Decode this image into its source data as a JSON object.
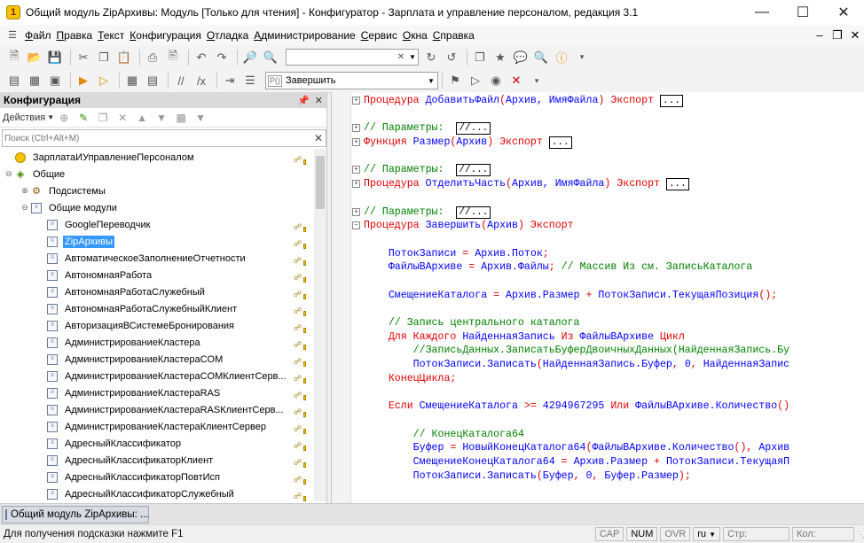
{
  "window": {
    "title": "Общий модуль ZipАрхивы: Модуль [Только для чтения] - Конфигуратор - Зарплата и управление персоналом, редакция 3.1"
  },
  "menu": [
    "Файл",
    "Правка",
    "Текст",
    "Конфигурация",
    "Отладка",
    "Администрирование",
    "Сервис",
    "Окна",
    "Справка"
  ],
  "toolbar": {
    "search_value": "",
    "procedure_value": "Завершить",
    "proc_tag": "P()"
  },
  "config_panel": {
    "title": "Конфигурация",
    "actions_label": "Действия",
    "search_placeholder": "Поиск (Ctrl+Alt+M)"
  },
  "tree": [
    {
      "label": "ЗарплатаИУправлениеПерсоналом",
      "level": 0,
      "exp": "",
      "icon": "root",
      "lock": true
    },
    {
      "label": "Общие",
      "level": 0,
      "exp": "⊖",
      "icon": "common",
      "lock": false
    },
    {
      "label": "Подсистемы",
      "level": 1,
      "exp": "⊕",
      "icon": "subsys",
      "lock": false
    },
    {
      "label": "Общие модули",
      "level": 1,
      "exp": "⊖",
      "icon": "module",
      "lock": false
    },
    {
      "label": "GoogleПереводчик",
      "level": 2,
      "exp": "",
      "icon": "module",
      "lock": true
    },
    {
      "label": "ZipАрхивы",
      "level": 2,
      "exp": "",
      "icon": "module",
      "lock": true,
      "selected": true
    },
    {
      "label": "АвтоматическоеЗаполнениеОтчетности",
      "level": 2,
      "exp": "",
      "icon": "module",
      "lock": true
    },
    {
      "label": "АвтономнаяРабота",
      "level": 2,
      "exp": "",
      "icon": "module",
      "lock": true
    },
    {
      "label": "АвтономнаяРаботаСлужебный",
      "level": 2,
      "exp": "",
      "icon": "module",
      "lock": true
    },
    {
      "label": "АвтономнаяРаботаСлужебныйКлиент",
      "level": 2,
      "exp": "",
      "icon": "module",
      "lock": true
    },
    {
      "label": "АвторизацияВСистемеБронирования",
      "level": 2,
      "exp": "",
      "icon": "module",
      "lock": true
    },
    {
      "label": "АдминистрированиеКластера",
      "level": 2,
      "exp": "",
      "icon": "module",
      "lock": true
    },
    {
      "label": "АдминистрированиеКластераCOM",
      "level": 2,
      "exp": "",
      "icon": "module",
      "lock": true
    },
    {
      "label": "АдминистрированиеКластераCOMКлиентСерв...",
      "level": 2,
      "exp": "",
      "icon": "module",
      "lock": true
    },
    {
      "label": "АдминистрированиеКластераRAS",
      "level": 2,
      "exp": "",
      "icon": "module",
      "lock": true
    },
    {
      "label": "АдминистрированиеКластераRASКлиентСерв...",
      "level": 2,
      "exp": "",
      "icon": "module",
      "lock": true
    },
    {
      "label": "АдминистрированиеКластераКлиентСервер",
      "level": 2,
      "exp": "",
      "icon": "module",
      "lock": true
    },
    {
      "label": "АдресныйКлассификатор",
      "level": 2,
      "exp": "",
      "icon": "module",
      "lock": true
    },
    {
      "label": "АдресныйКлассификаторКлиент",
      "level": 2,
      "exp": "",
      "icon": "module",
      "lock": true
    },
    {
      "label": "АдресныйКлассификаторПовтИсп",
      "level": 2,
      "exp": "",
      "icon": "module",
      "lock": true
    },
    {
      "label": "АдресныйКлассификаторСлужебный",
      "level": 2,
      "exp": "",
      "icon": "module",
      "lock": true
    }
  ],
  "code": [
    {
      "fold": "+",
      "parts": [
        [
          "kw",
          "Процедура "
        ],
        [
          "id",
          "ДобавитьФайл"
        ],
        [
          "kw",
          "("
        ],
        [
          "id",
          "Архив, ИмяФайла"
        ],
        [
          "kw",
          ") Экспорт "
        ],
        [
          "box",
          "..."
        ]
      ]
    },
    {
      "parts": []
    },
    {
      "fold": "+",
      "parts": [
        [
          "cm",
          "// Параметры:  "
        ],
        [
          "box",
          "//..."
        ]
      ]
    },
    {
      "fold": "+",
      "parts": [
        [
          "kw",
          "Функция "
        ],
        [
          "id",
          "Размер"
        ],
        [
          "kw",
          "("
        ],
        [
          "id",
          "Архив"
        ],
        [
          "kw",
          ") Экспорт "
        ],
        [
          "box",
          "..."
        ]
      ]
    },
    {
      "parts": []
    },
    {
      "fold": "+",
      "parts": [
        [
          "cm",
          "// Параметры:  "
        ],
        [
          "box",
          "//..."
        ]
      ]
    },
    {
      "fold": "+",
      "parts": [
        [
          "kw",
          "Процедура "
        ],
        [
          "id",
          "ОтделитьЧасть"
        ],
        [
          "kw",
          "("
        ],
        [
          "id",
          "Архив, ИмяФайла"
        ],
        [
          "kw",
          ") Экспорт "
        ],
        [
          "box",
          "..."
        ]
      ]
    },
    {
      "parts": []
    },
    {
      "fold": "+",
      "parts": [
        [
          "cm",
          "// Параметры:  "
        ],
        [
          "box",
          "//..."
        ]
      ]
    },
    {
      "fold": "-",
      "parts": [
        [
          "kw",
          "Процедура "
        ],
        [
          "id",
          "Завершить"
        ],
        [
          "kw",
          "("
        ],
        [
          "id",
          "Архив"
        ],
        [
          "kw",
          ") Экспорт"
        ]
      ]
    },
    {
      "parts": []
    },
    {
      "parts": [
        [
          "id",
          "    ПотокЗаписи "
        ],
        [
          "kw",
          "= "
        ],
        [
          "id",
          "Архив.Поток"
        ],
        [
          "kw",
          ";"
        ]
      ]
    },
    {
      "parts": [
        [
          "id",
          "    ФайлыВАрхиве "
        ],
        [
          "kw",
          "= "
        ],
        [
          "id",
          "Архив.Файлы"
        ],
        [
          "kw",
          "; "
        ],
        [
          "cm",
          "// Массив Из см. ЗаписьКаталога"
        ]
      ]
    },
    {
      "parts": []
    },
    {
      "parts": [
        [
          "id",
          "    СмещениеКаталога "
        ],
        [
          "kw",
          "= "
        ],
        [
          "id",
          "Архив.Размер "
        ],
        [
          "kw",
          "+ "
        ],
        [
          "id",
          "ПотокЗаписи.ТекущаяПозиция"
        ],
        [
          "kw",
          "();"
        ]
      ]
    },
    {
      "parts": []
    },
    {
      "parts": [
        [
          "cm",
          "    // Запись центрального каталога"
        ]
      ]
    },
    {
      "parts": [
        [
          "kw",
          "    Для Каждого "
        ],
        [
          "id",
          "НайденнаяЗапись "
        ],
        [
          "kw",
          "Из "
        ],
        [
          "id",
          "ФайлыВАрхиве "
        ],
        [
          "kw",
          "Цикл"
        ]
      ]
    },
    {
      "parts": [
        [
          "cm",
          "        //ЗаписьДанных.ЗаписатьБуферДвоичныхДанных(НайденнаяЗапись.Бу"
        ]
      ]
    },
    {
      "parts": [
        [
          "id",
          "        ПотокЗаписи.Записать"
        ],
        [
          "kw",
          "("
        ],
        [
          "id",
          "НайденнаяЗапись.Буфер"
        ],
        [
          "kw",
          ", "
        ],
        [
          "id",
          "0"
        ],
        [
          "kw",
          ", "
        ],
        [
          "id",
          "НайденнаяЗапис"
        ]
      ]
    },
    {
      "parts": [
        [
          "kw",
          "    КонецЦикла;"
        ]
      ]
    },
    {
      "parts": []
    },
    {
      "parts": [
        [
          "kw",
          "    Если "
        ],
        [
          "id",
          "СмещениеКаталога "
        ],
        [
          "kw",
          ">= "
        ],
        [
          "id",
          "4294967295 "
        ],
        [
          "kw",
          "Или "
        ],
        [
          "id",
          "ФайлыВАрхиве.Количество"
        ],
        [
          "kw",
          "()"
        ]
      ]
    },
    {
      "parts": []
    },
    {
      "parts": [
        [
          "cm",
          "        // КонецКаталога64"
        ]
      ]
    },
    {
      "parts": [
        [
          "id",
          "        Буфер "
        ],
        [
          "kw",
          "= "
        ],
        [
          "id",
          "НовыйКонецКаталога64"
        ],
        [
          "kw",
          "("
        ],
        [
          "id",
          "ФайлыВАрхиве.Количество"
        ],
        [
          "kw",
          "(), "
        ],
        [
          "id",
          "Архив"
        ]
      ]
    },
    {
      "parts": [
        [
          "id",
          "        СмещениеКонецКаталога64 "
        ],
        [
          "kw",
          "= "
        ],
        [
          "id",
          "Архив.Размер "
        ],
        [
          "kw",
          "+ "
        ],
        [
          "id",
          "ПотокЗаписи.ТекущаяП"
        ]
      ]
    },
    {
      "parts": [
        [
          "id",
          "        ПотокЗаписи.Записать"
        ],
        [
          "kw",
          "("
        ],
        [
          "id",
          "Буфер"
        ],
        [
          "kw",
          ", "
        ],
        [
          "id",
          "0"
        ],
        [
          "kw",
          ", "
        ],
        [
          "id",
          "Буфер.Размер"
        ],
        [
          "kw",
          ");"
        ]
      ]
    }
  ],
  "bottom_tab": {
    "label": "Общий модуль ZipАрхивы: ..."
  },
  "status": {
    "hint": "Для получения подсказки нажмите F1",
    "cap": "CAP",
    "num": "NUM",
    "ovr": "OVR",
    "lang": "ru",
    "row": "Стр:",
    "col": "Кол:"
  }
}
